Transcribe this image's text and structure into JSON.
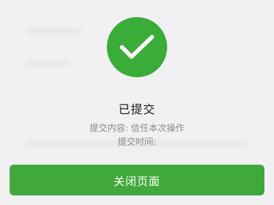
{
  "result": {
    "icon": "checkmark-icon",
    "icon_color": "#3aac38",
    "title": "已提交"
  },
  "details": {
    "content_label": "提交内容:",
    "content_value": "信任本次操作",
    "time_label": "提交时间:",
    "time_value": ""
  },
  "actions": {
    "close_label": "关闭页面",
    "close_color": "#41a83b"
  }
}
